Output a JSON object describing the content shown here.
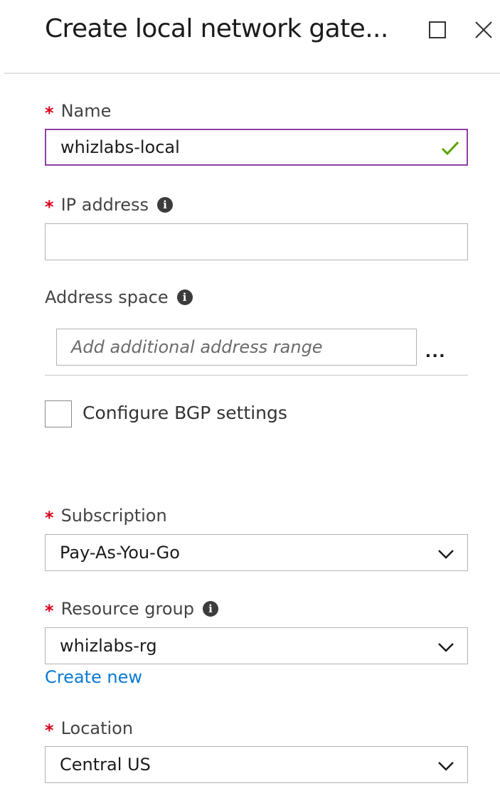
{
  "header": {
    "title": "Create local network gate...",
    "maximize_icon": "maximize-icon",
    "close_icon": "close-icon"
  },
  "form": {
    "required_marker": "*",
    "name": {
      "label": "Name",
      "value": "whizlabs-local",
      "valid": true
    },
    "ip_address": {
      "label": "IP address",
      "value": "",
      "placeholder": ""
    },
    "address_space": {
      "label": "Address space",
      "placeholder": "Add additional address range",
      "more_label": "..."
    },
    "bgp": {
      "label": "Configure BGP settings",
      "checked": false
    },
    "subscription": {
      "label": "Subscription",
      "selected": "Pay-As-You-Go"
    },
    "resource_group": {
      "label": "Resource group",
      "selected": "whizlabs-rg",
      "create_new_label": "Create new"
    },
    "location": {
      "label": "Location",
      "selected": "Central US"
    },
    "info_glyph": "i"
  },
  "colors": {
    "required": "#d9001b",
    "valid_border": "#8b3fa6",
    "valid_check": "#57a300",
    "link": "#0a7ad1"
  }
}
